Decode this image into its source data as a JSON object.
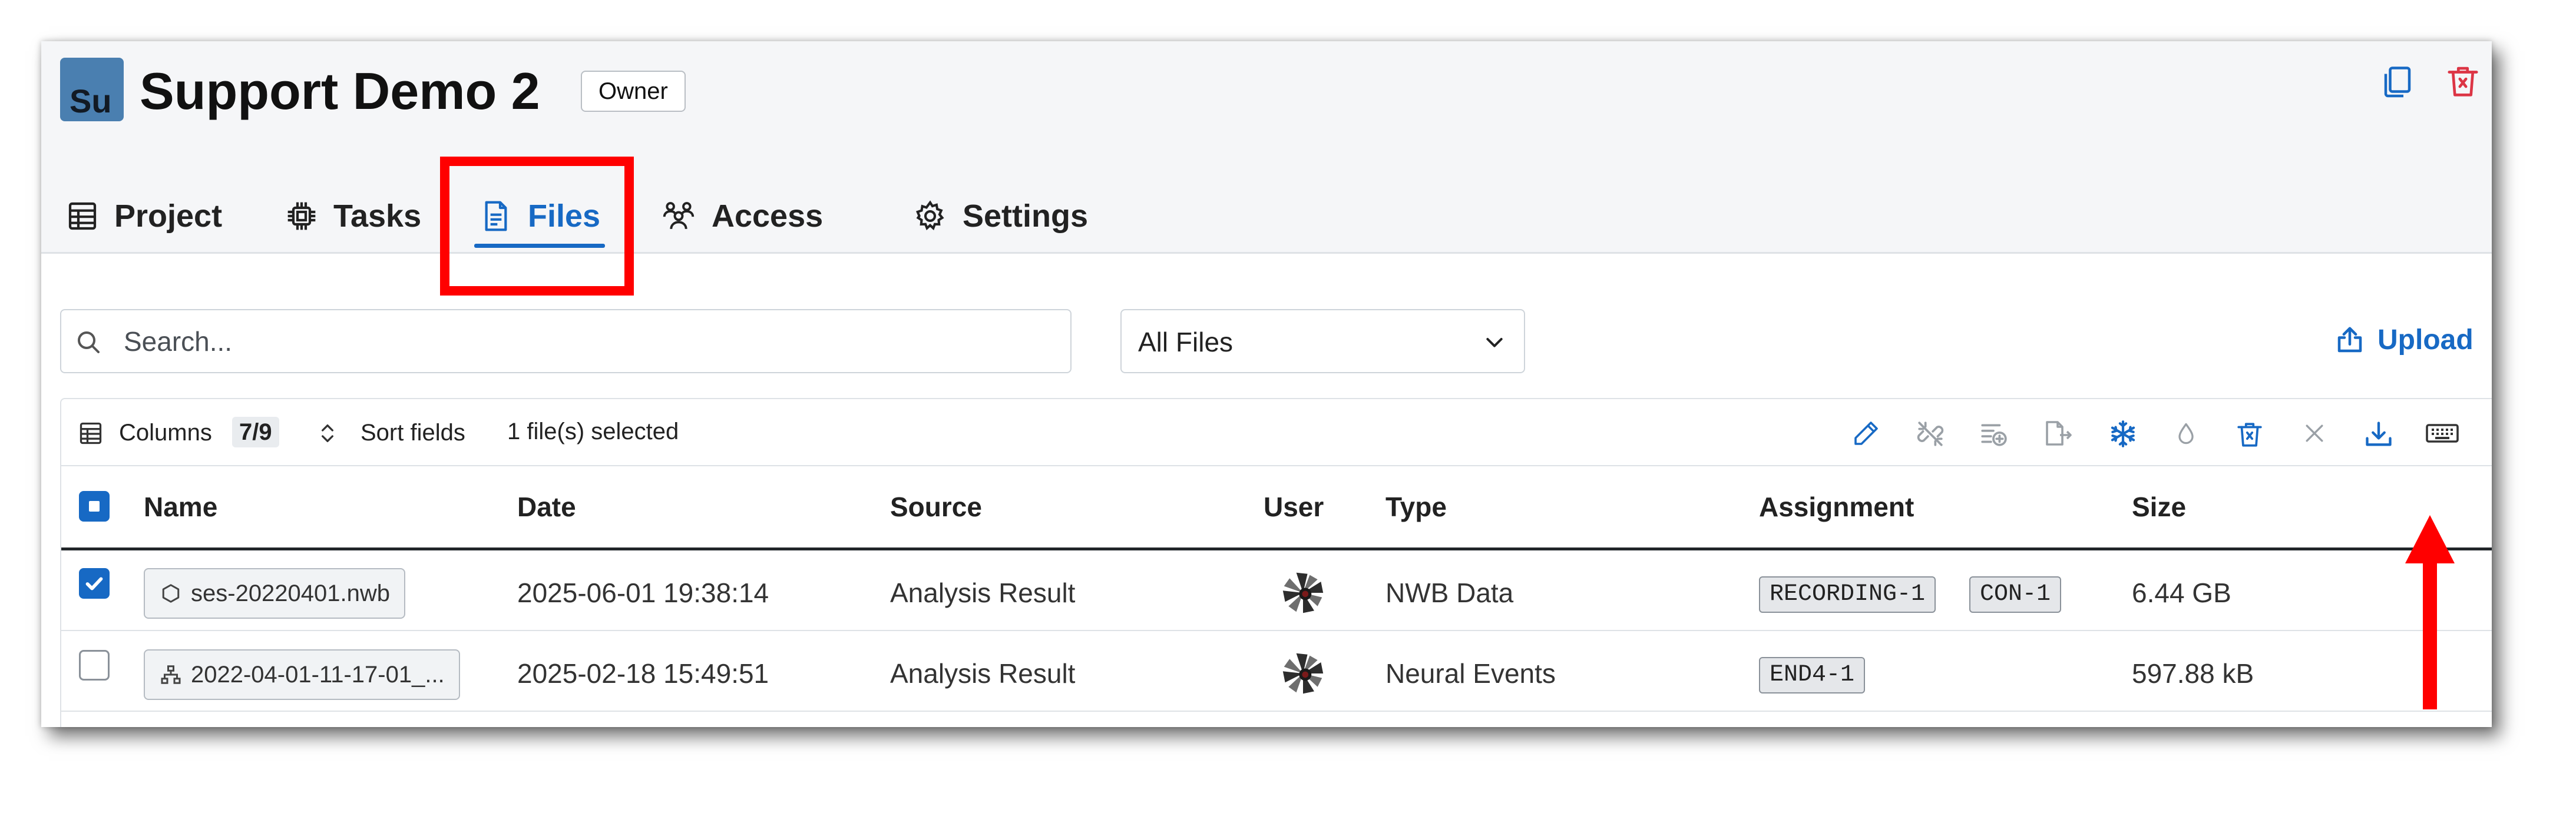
{
  "project": {
    "avatar_text": "Su",
    "title": "Support Demo 2",
    "role": "Owner",
    "avatar_color": "#4a7fb0"
  },
  "header_actions": {
    "copy_icon": "copy-icon",
    "delete_icon": "trash-icon"
  },
  "tabs": [
    {
      "label": "Project",
      "icon": "table-icon",
      "active": false
    },
    {
      "label": "Tasks",
      "icon": "cpu-icon",
      "active": false
    },
    {
      "label": "Files",
      "icon": "file-text-icon",
      "active": true
    },
    {
      "label": "Access",
      "icon": "people-icon",
      "active": false
    },
    {
      "label": "Settings",
      "icon": "gear-icon",
      "active": false
    }
  ],
  "search": {
    "placeholder": "Search...",
    "value": ""
  },
  "file_filter": {
    "selected": "All Files"
  },
  "upload": {
    "label": "Upload"
  },
  "toolbar": {
    "columns_label": "Columns",
    "columns_count": "7/9",
    "sort_label": "Sort fields",
    "selection_status": "1 file(s) selected",
    "action_icons": [
      "pencil-icon",
      "unlink-icon",
      "add-to-queue-icon",
      "move-file-icon",
      "snowflake-icon",
      "droplet-icon",
      "trash-icon",
      "close-icon",
      "download-icon",
      "keyboard-icon"
    ]
  },
  "table": {
    "columns": [
      "Name",
      "Date",
      "Source",
      "User",
      "Type",
      "Assignment",
      "Size"
    ],
    "rows": [
      {
        "checked": true,
        "name": "ses-20220401.nwb",
        "name_icon": "hexagon-icon",
        "date": "2025-06-01 19:38:14",
        "source": "Analysis Result",
        "type": "NWB Data",
        "assignment": [
          "RECORDING-1",
          "CON-1"
        ],
        "size": "6.44 GB"
      },
      {
        "checked": false,
        "name": "2022-04-01-11-17-01_...",
        "name_icon": "hierarchy-icon",
        "date": "2025-02-18 15:49:51",
        "source": "Analysis Result",
        "type": "Neural Events",
        "assignment": [
          "END4-1"
        ],
        "size": "597.88 kB"
      }
    ]
  },
  "colors": {
    "accent": "#1769c4",
    "annotation": "#ff0000",
    "danger": "#dc3545",
    "header_bg": "#f5f6f8"
  }
}
